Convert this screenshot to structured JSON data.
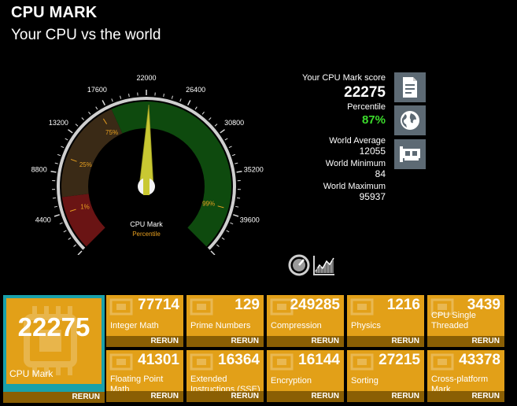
{
  "header": {
    "title": "CPU MARK",
    "subtitle": "Your CPU vs the world"
  },
  "gauge": {
    "ticks": [
      "0",
      "4400",
      "8800",
      "13200",
      "17600",
      "22000",
      "26400",
      "30800",
      "35200",
      "39600",
      "44000"
    ],
    "percentile_marks": [
      "1%",
      "25%",
      "75%",
      "99%"
    ],
    "center_label": "CPU Mark",
    "center_sublabel": "Percentile",
    "needle_value": 22275,
    "max_value": 44000,
    "colors": {
      "low": "#6a1414",
      "mid": "#3a2a16",
      "high": "#0e4a0e",
      "needle": "#c9c832",
      "tick_label": "#ffffff",
      "percent_label": "#e8a020"
    }
  },
  "score": {
    "label": "Your CPU Mark score",
    "value": "22275",
    "percentile_label": "Percentile",
    "percentile_value": "87%",
    "world_average_label": "World Average",
    "world_average": "12055",
    "world_minimum_label": "World Minimum",
    "world_minimum": "84",
    "world_maximum_label": "World Maximum",
    "world_maximum": "95937"
  },
  "side_buttons": [
    "document-icon",
    "globe-icon",
    "hardware-card-icon"
  ],
  "bottom_icons": [
    "speedometer-icon",
    "chart-icon"
  ],
  "main_tile": {
    "value": "22275",
    "name": "CPU Mark",
    "rerun": "RERUN"
  },
  "tiles": [
    {
      "value": "77714",
      "name": "Integer Math",
      "rerun": "RERUN"
    },
    {
      "value": "129",
      "name": "Prime Numbers",
      "rerun": "RERUN"
    },
    {
      "value": "249285",
      "name": "Compression",
      "rerun": "RERUN"
    },
    {
      "value": "1216",
      "name": "Physics",
      "rerun": "RERUN"
    },
    {
      "value": "3439",
      "name": "CPU Single Threaded",
      "rerun": "RERUN"
    },
    {
      "value": "41301",
      "name": "Floating Point Math",
      "rerun": "RERUN"
    },
    {
      "value": "16364",
      "name": "Extended Instructions (SSE)",
      "rerun": "RERUN"
    },
    {
      "value": "16144",
      "name": "Encryption",
      "rerun": "RERUN"
    },
    {
      "value": "27215",
      "name": "Sorting",
      "rerun": "RERUN"
    },
    {
      "value": "43378",
      "name": "Cross-platform Mark",
      "rerun": "RERUN"
    }
  ],
  "accent_colors": {
    "tile": "#e2a018",
    "tile_bar": "#8a5f04",
    "main_border": "#1aa1aa",
    "side_button": "#5d6a74"
  }
}
